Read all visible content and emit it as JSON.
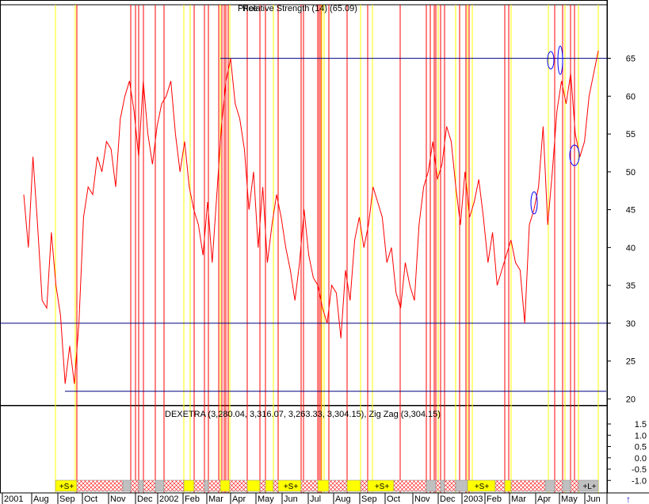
{
  "chart_data": [
    {
      "type": "line",
      "title": "Relative Strength (14) (65.09)",
      "title_overlap": [
        "Price",
        "Relative Strength (14) (65.09)"
      ],
      "ylim": [
        17,
        70
      ],
      "y_ticks": [
        65,
        60,
        55,
        50,
        45,
        40,
        35,
        30,
        25,
        20
      ],
      "x_ticks": [
        "2001",
        "Aug",
        "Sep",
        "Oct",
        "Nov",
        "Dec",
        "2002",
        "Feb",
        "Mar",
        "Apr",
        "May",
        "Jun",
        "Jul",
        "Aug",
        "Sep",
        "Oct",
        "Nov",
        "Dec",
        "2003",
        "Feb",
        "Mar",
        "Apr",
        "May",
        "Jun"
      ],
      "series": [
        {
          "color": "#ff0000",
          "x": [
            0,
            2,
            4,
            6,
            8,
            10,
            12,
            14,
            16,
            18,
            20,
            22,
            24,
            26,
            28,
            30,
            32,
            34,
            36,
            38,
            40,
            42,
            44,
            46,
            48,
            50,
            52,
            54,
            56,
            58,
            60,
            62,
            64,
            66,
            68,
            70,
            72,
            74,
            76,
            78,
            80,
            82,
            84,
            86,
            88,
            90,
            92,
            94,
            96,
            98,
            100,
            102,
            104,
            106,
            108,
            110,
            112,
            114,
            116,
            118,
            120,
            122,
            124,
            126,
            128,
            130,
            132,
            134,
            136,
            138,
            140,
            142,
            144,
            146,
            148,
            150,
            152,
            154,
            156,
            158,
            160,
            162,
            164,
            166,
            168,
            170,
            172,
            174,
            176,
            178,
            180,
            182,
            184,
            186,
            188,
            190,
            192,
            194,
            196,
            198,
            200,
            202,
            204,
            206,
            208,
            210,
            212,
            214,
            216,
            218,
            220,
            222,
            224,
            226,
            228,
            230,
            232,
            234,
            236,
            238,
            240,
            242,
            244,
            246,
            248,
            250
          ],
          "values": [
            47,
            40,
            52,
            43,
            33,
            32,
            42,
            35,
            31,
            22,
            27,
            22,
            30,
            44,
            48,
            47,
            52,
            50,
            54,
            53,
            48,
            57,
            60,
            62,
            58,
            52,
            62,
            55,
            51,
            56,
            59,
            60,
            62,
            55,
            50,
            54,
            48,
            45,
            43,
            39,
            46,
            38,
            47,
            56,
            62,
            65,
            59,
            57,
            53,
            45,
            50,
            40,
            48,
            38,
            43,
            47,
            44,
            40,
            37,
            33,
            38,
            45,
            39,
            36,
            35,
            32,
            30,
            35,
            34,
            28,
            37,
            33,
            41,
            44,
            40,
            43,
            48,
            46,
            44,
            38,
            40,
            34,
            32,
            38,
            35,
            33,
            43,
            48,
            50,
            54,
            49,
            51,
            56,
            54,
            48,
            43,
            50,
            44,
            46,
            49,
            44,
            38,
            42,
            35,
            37,
            39,
            41,
            38,
            37,
            30,
            43,
            45,
            48,
            56,
            43,
            50,
            58,
            62,
            59,
            63,
            55,
            52,
            54,
            60,
            63,
            66
          ]
        },
        {
          "color": "#000080",
          "name": "",
          "values": [
            65,
            30,
            21
          ]
        }
      ]
    },
    {
      "type": "line",
      "title": "DEXETRA (3,280.04, 3,316.07, 3,263.33, 3,304.15), Zig Zag (3,304.15)",
      "ylim": [
        -1.25,
        1.6
      ],
      "y_ticks": [
        "1.5",
        "1.0",
        "0.5",
        "0.0",
        "-0.5",
        "-1.0"
      ],
      "series": []
    }
  ],
  "signal_labels": [
    "+S+",
    "+S+",
    "+S+",
    "+S+",
    "+L+"
  ],
  "colors": {
    "price": "#ff0000",
    "hline": "#000080",
    "vline_red": "#ff0000",
    "vline_yellow": "#ffff00",
    "ellipse": "#0000ff",
    "hatch": "#ff0000",
    "gray": "#c0c0c0"
  }
}
